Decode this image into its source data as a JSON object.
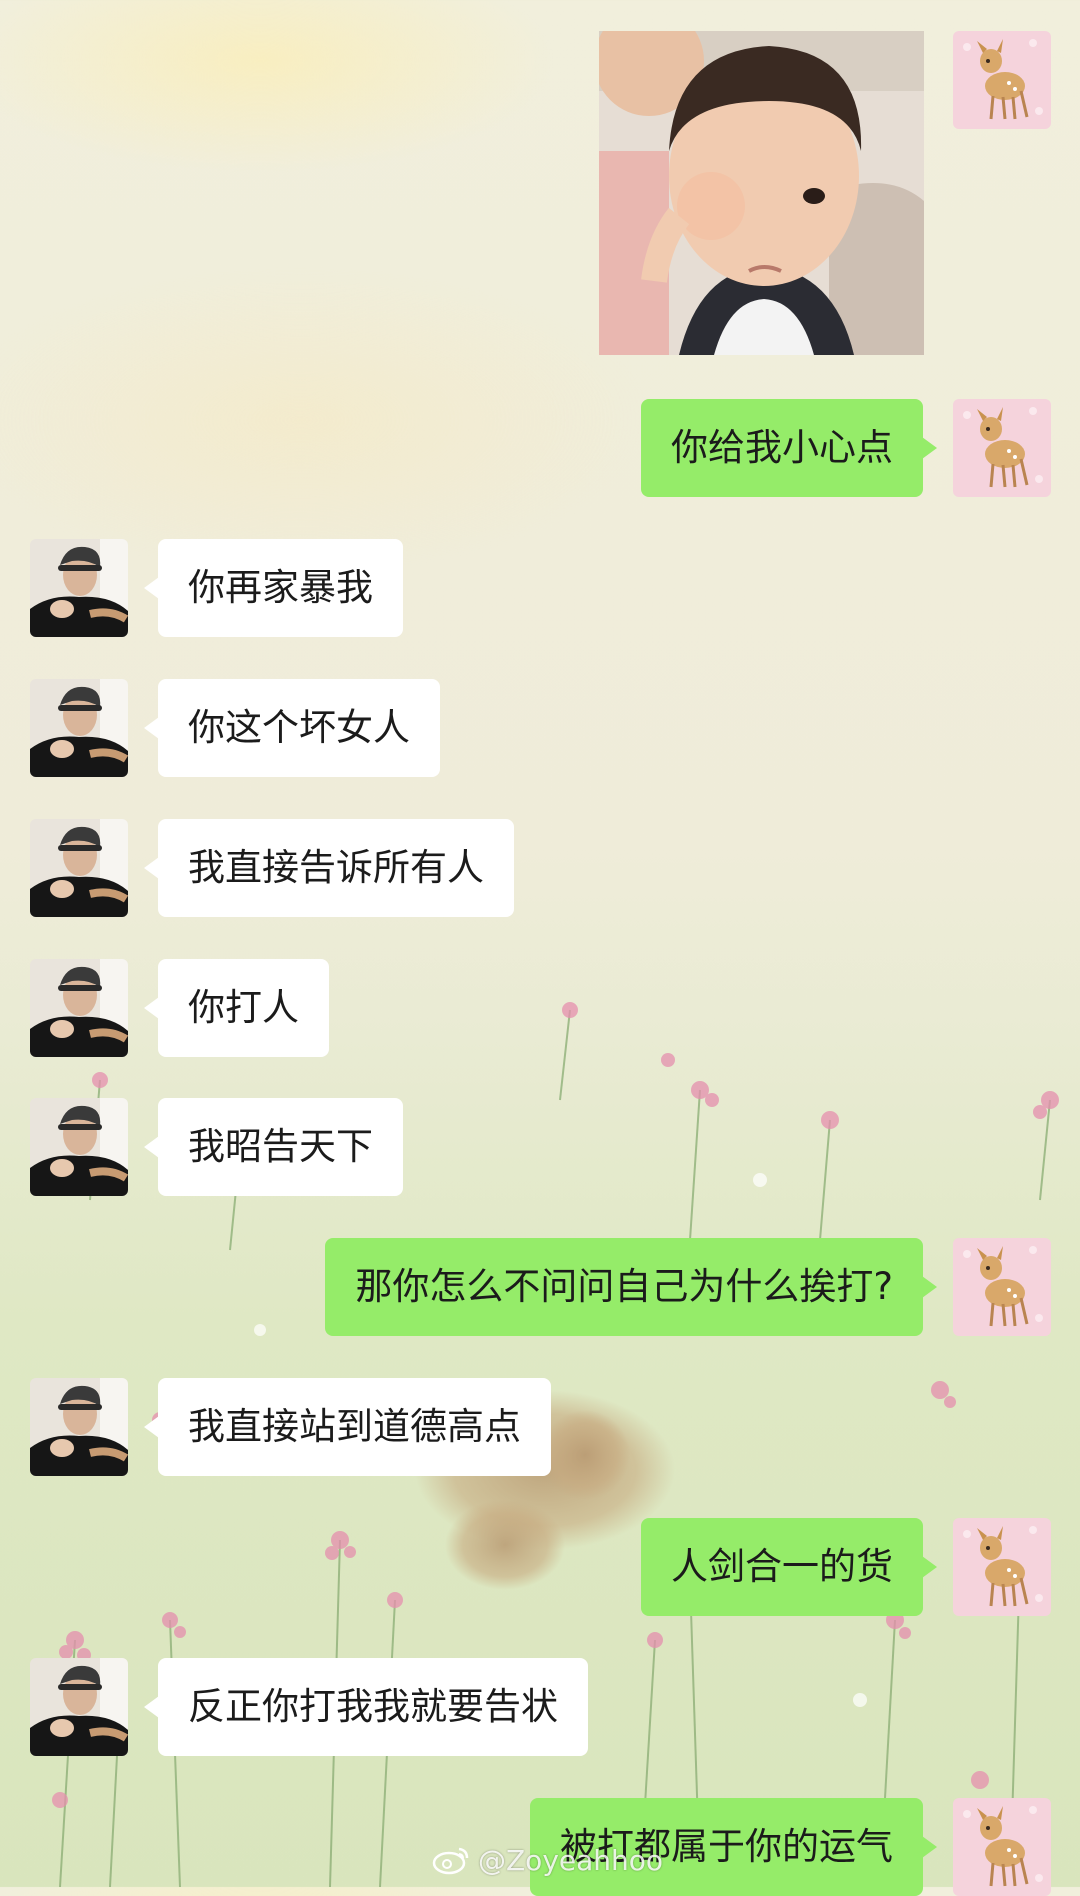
{
  "sticker": {
    "icon": "baby-fist-sticker"
  },
  "messages": [
    {
      "side": "out",
      "text": "你给我小心点"
    },
    {
      "side": "in",
      "text": "你再家暴我"
    },
    {
      "side": "in",
      "text": "你这个坏女人"
    },
    {
      "side": "in",
      "text": "我直接告诉所有人"
    },
    {
      "side": "in",
      "text": "你打人"
    },
    {
      "side": "in",
      "text": "我昭告天下"
    },
    {
      "side": "out",
      "text": "那你怎么不问问自己为什么挨打?"
    },
    {
      "side": "in",
      "text": "我直接站到道德高点"
    },
    {
      "side": "out",
      "text": "人剑合一的货"
    },
    {
      "side": "in",
      "text": "反正你打我我就要告状"
    },
    {
      "side": "out",
      "text": "被打都属于你的运气"
    }
  ],
  "avatars": {
    "left": "man-cap-avatar",
    "right": "fawn-avatar"
  },
  "watermark": {
    "icon": "weibo-logo",
    "text": "@Zoyeahhoo"
  },
  "colors": {
    "incoming_bubble": "#ffffff",
    "outgoing_bubble": "#95ec69"
  }
}
